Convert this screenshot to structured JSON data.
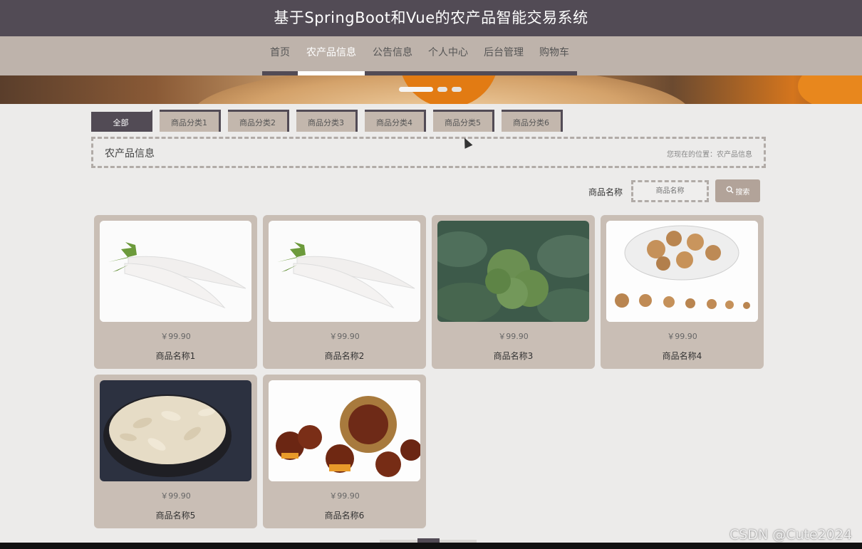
{
  "header": {
    "title": "基于SpringBoot和Vue的农产品智能交易系统"
  },
  "nav": {
    "items": [
      {
        "label": "首页",
        "active": false
      },
      {
        "label": "农产品信息",
        "active": true
      },
      {
        "label": "公告信息",
        "active": false
      },
      {
        "label": "个人中心",
        "active": false
      },
      {
        "label": "后台管理",
        "active": false
      },
      {
        "label": "购物车",
        "active": false
      }
    ]
  },
  "categories": [
    {
      "label": "全部",
      "active": true
    },
    {
      "label": "商品分类1",
      "active": false
    },
    {
      "label": "商品分类2",
      "active": false
    },
    {
      "label": "商品分类3",
      "active": false
    },
    {
      "label": "商品分类4",
      "active": false
    },
    {
      "label": "商品分类5",
      "active": false
    },
    {
      "label": "商品分类6",
      "active": false
    }
  ],
  "breadcrumb": {
    "title": "农产品信息",
    "path": "您现在的位置：农产品信息"
  },
  "search": {
    "label": "商品名称",
    "placeholder": "商品名称",
    "button": "搜索"
  },
  "products": [
    {
      "price": "￥99.90",
      "name": "商品名称1",
      "image": "radish"
    },
    {
      "price": "￥99.90",
      "name": "商品名称2",
      "image": "radish"
    },
    {
      "price": "￥99.90",
      "name": "商品名称3",
      "image": "broccoli"
    },
    {
      "price": "￥99.90",
      "name": "商品名称4",
      "image": "dried-roots"
    },
    {
      "price": "￥99.90",
      "name": "商品名称5",
      "image": "melon-seeds"
    },
    {
      "price": "￥99.90",
      "name": "商品名称6",
      "image": "chestnuts"
    }
  ],
  "watermark": "CSDN @Cute2024",
  "colors": {
    "header_bg": "#524b55",
    "nav_bg": "#beb3ab",
    "card_bg": "#c9beb5",
    "accent": "#b2a399"
  }
}
